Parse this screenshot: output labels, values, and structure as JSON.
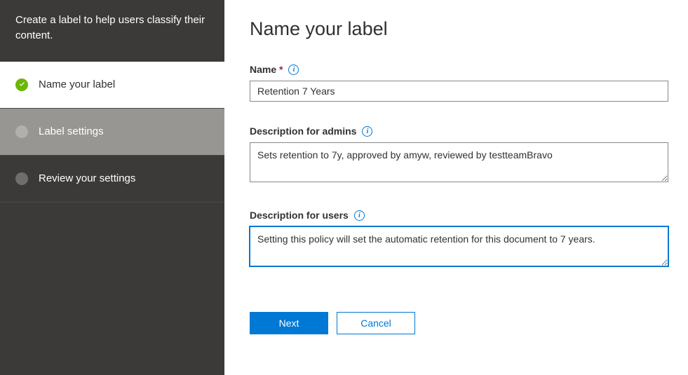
{
  "sidebar": {
    "header": "Create a label to help users classify their content.",
    "steps": [
      {
        "label": "Name your label",
        "status": "completed"
      },
      {
        "label": "Label settings",
        "status": "current"
      },
      {
        "label": "Review your settings",
        "status": "pending"
      }
    ]
  },
  "main": {
    "title": "Name your label",
    "name_field": {
      "label": "Name",
      "required": "*",
      "value": "Retention 7 Years"
    },
    "admin_desc_field": {
      "label": "Description for admins",
      "value": "Sets retention to 7y, approved by amyw, reviewed by testteamBravo"
    },
    "user_desc_field": {
      "label": "Description for users",
      "value": "Setting this policy will set the automatic retention for this document to 7 years."
    },
    "buttons": {
      "next": "Next",
      "cancel": "Cancel"
    }
  }
}
